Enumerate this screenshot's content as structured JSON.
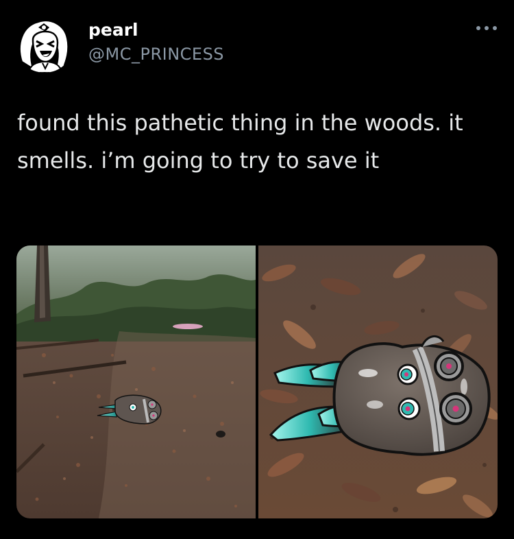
{
  "tweet": {
    "display_name": "pearl",
    "handle": "@MC_PRINCESS",
    "text": "found this pathetic thing in the woods. it smells. i’m going to try to save it",
    "more_icon": "ellipsis-icon",
    "avatar_icon": "avatar-doodle-icon"
  },
  "media": {
    "photos": [
      {
        "subject": "woods-path-photo"
      },
      {
        "subject": "leaf-litter-closeup-photo"
      }
    ]
  },
  "colors": {
    "background": "#000000",
    "text": "#e7e9ea",
    "secondary_text": "#8b98a5",
    "creature_teal": "#2fb9b0",
    "creature_body": "#5e5550",
    "creature_eye": "#d6357a"
  }
}
